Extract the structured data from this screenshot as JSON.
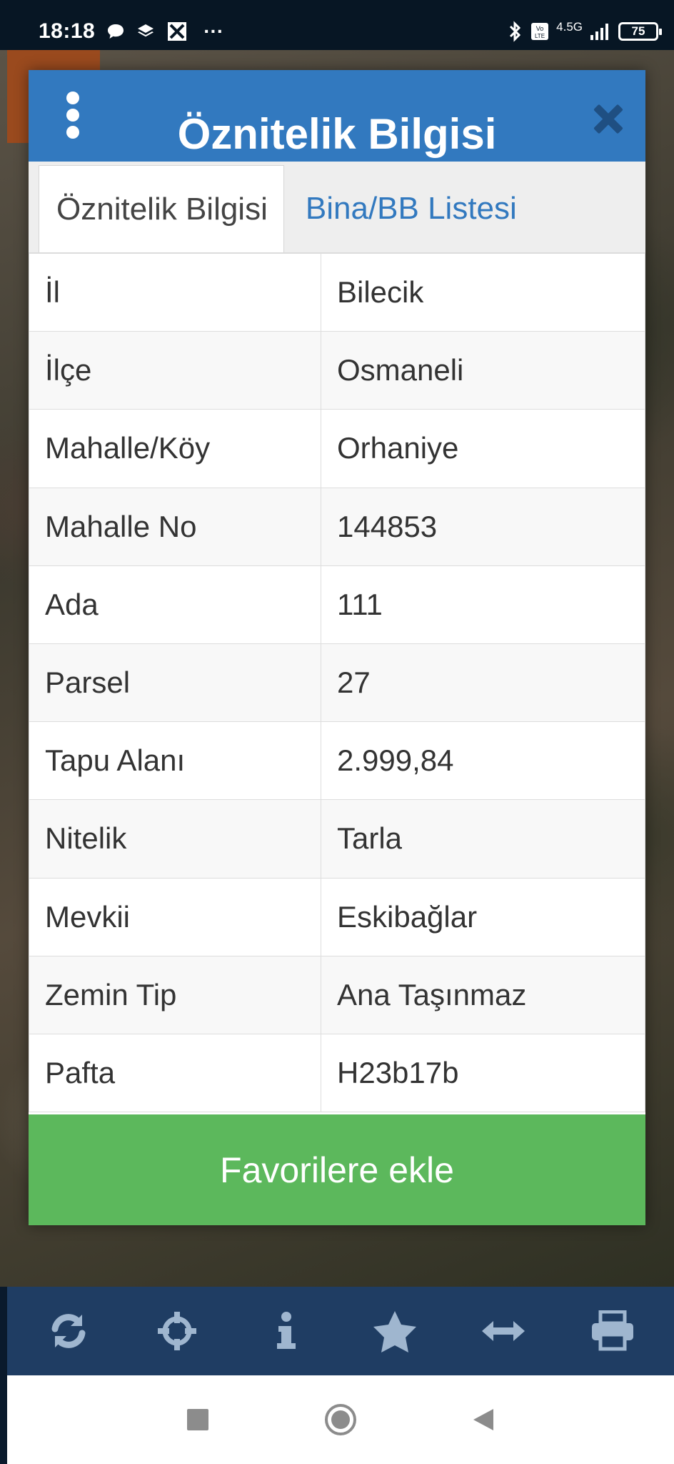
{
  "status_bar": {
    "time": "18:18",
    "more": "···",
    "network": "4.5G",
    "battery": "75"
  },
  "modal": {
    "title": "Öznitelik Bilgisi",
    "tabs": [
      {
        "label": "Öznitelik Bilgisi",
        "active": true
      },
      {
        "label": "Bina/BB Listesi",
        "active": false
      }
    ],
    "rows": [
      {
        "key": "İl",
        "value": "Bilecik"
      },
      {
        "key": "İlçe",
        "value": "Osmaneli"
      },
      {
        "key": "Mahalle/Köy",
        "value": "Orhaniye"
      },
      {
        "key": "Mahalle No",
        "value": "144853"
      },
      {
        "key": "Ada",
        "value": "111"
      },
      {
        "key": "Parsel",
        "value": "27"
      },
      {
        "key": "Tapu Alanı",
        "value": "2.999,84"
      },
      {
        "key": "Nitelik",
        "value": "Tarla"
      },
      {
        "key": "Mevkii",
        "value": "Eskibağlar"
      },
      {
        "key": "Zemin Tip",
        "value": "Ana Taşınmaz"
      },
      {
        "key": "Pafta",
        "value": "H23b17b"
      }
    ],
    "favorite_button": "Favorilere ekle"
  },
  "toolbar": {
    "icons": [
      "refresh-icon",
      "crosshairs-icon",
      "info-icon",
      "star-icon",
      "measure-icon",
      "print-icon"
    ],
    "color": "#9fb6cf"
  },
  "colors": {
    "header": "#3279bf",
    "favorite": "#5cb85c",
    "toolbar": "#1f3d63"
  }
}
